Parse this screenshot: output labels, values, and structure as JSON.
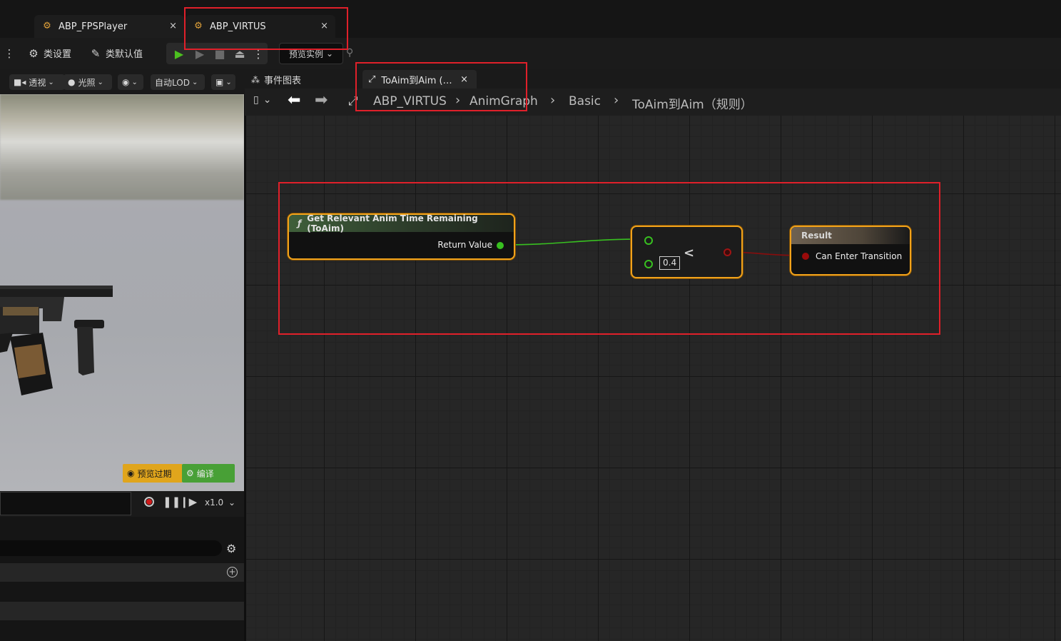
{
  "tabs": [
    {
      "label": "ABP_FPSPlayer",
      "close": "×"
    },
    {
      "label": "ABP_VIRTUS",
      "close": "×"
    }
  ],
  "toolbar": {
    "class_settings": "类设置",
    "class_defaults": "类默认值",
    "preview_instance": "预览实例"
  },
  "viewport_toolbar": {
    "perspective": "透视",
    "lighting": "光照",
    "lod": "自动LOD"
  },
  "viewport": {
    "preview_expired": "预览过期",
    "compile": "编译"
  },
  "timeline": {
    "speed": "x1.0"
  },
  "panel_tabs": {
    "event_graph": "事件图表",
    "rule_tab": "ToAim到Aim (…",
    "rule_tab_close": "×"
  },
  "breadcrumb": [
    "ABP_VIRTUS",
    "AnimGraph",
    "Basic",
    "ToAim到Aim（规则）"
  ],
  "nodes": {
    "get_time": {
      "title": "Get Relevant Anim Time Remaining (ToAim)",
      "output": "Return Value"
    },
    "compare": {
      "operator": "<",
      "value": "0.4"
    },
    "result": {
      "title": "Result",
      "input": "Can Enter Transition"
    }
  },
  "colors": {
    "accent": "#f1a21b",
    "highlight_box": "#e0202a",
    "exec_green": "#38c020",
    "bool_red": "#9a0b0b"
  }
}
